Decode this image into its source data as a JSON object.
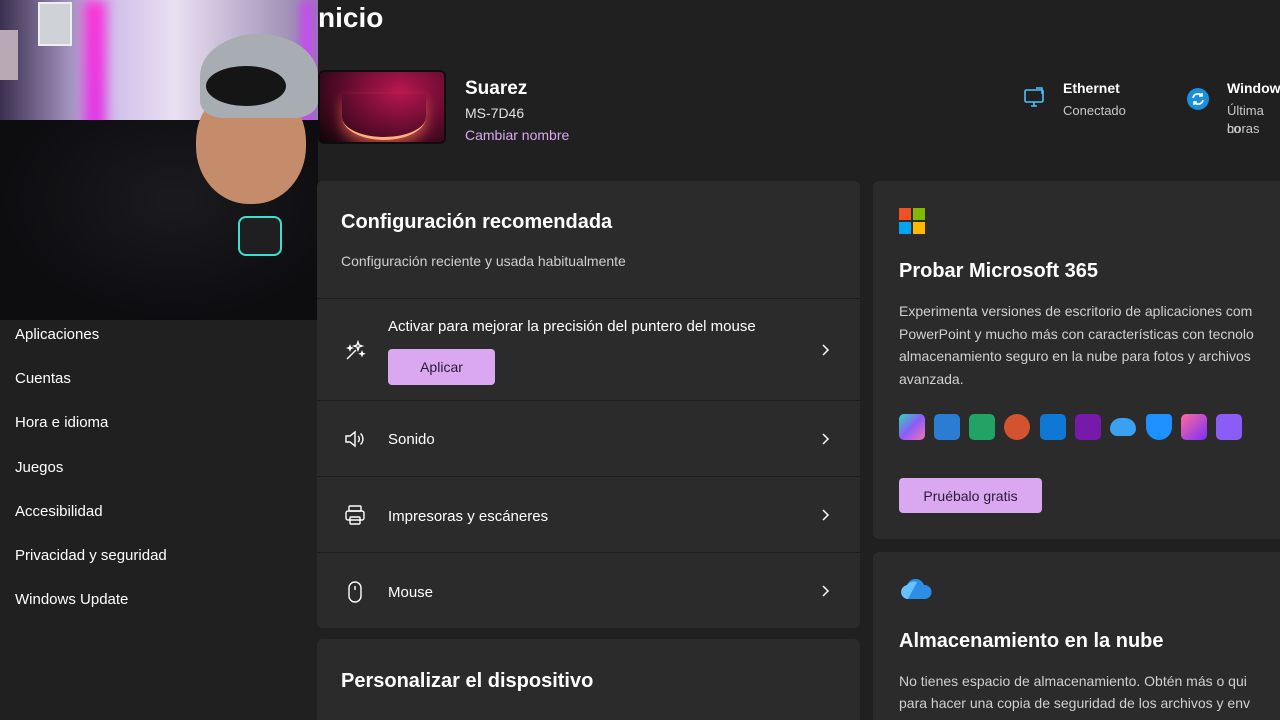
{
  "header": {
    "title": "nicio",
    "pc_name": "Suarez",
    "pc_model": "MS-7D46",
    "rename_link": "Cambiar nombre"
  },
  "status": {
    "ethernet": {
      "title": "Ethernet",
      "sub": "Conectado",
      "icon": "monitor-network-icon"
    },
    "update": {
      "title": "Window",
      "sub_line1": "Última co",
      "sub_line2": "horas",
      "icon": "sync-icon"
    }
  },
  "sidebar": {
    "items": [
      {
        "label": "Aplicaciones"
      },
      {
        "label": "Cuentas"
      },
      {
        "label": "Hora e idioma"
      },
      {
        "label": "Juegos"
      },
      {
        "label": "Accesibilidad"
      },
      {
        "label": "Privacidad y seguridad"
      },
      {
        "label": "Windows Update"
      }
    ]
  },
  "recommended": {
    "title": "Configuración recomendada",
    "subtitle": "Configuración reciente y usada habitualmente",
    "mouse_precision": {
      "label": "Activar para mejorar la precisión del puntero del mouse",
      "button": "Aplicar",
      "icon": "sparkle-pointer-icon"
    },
    "rows": [
      {
        "label": "Sonido",
        "icon": "speaker-icon"
      },
      {
        "label": "Impresoras y escáneres",
        "icon": "printer-icon"
      },
      {
        "label": "Mouse",
        "icon": "mouse-icon"
      }
    ]
  },
  "personalize": {
    "title": "Personalizar el dispositivo"
  },
  "m365": {
    "title": "Probar Microsoft 365",
    "lines": [
      "Experimenta versiones de escritorio de aplicaciones com",
      "PowerPoint y mucho más con características con tecnolo",
      "almacenamiento seguro en la nube para fotos y archivos",
      "avanzada."
    ],
    "button": "Pruébalo gratis",
    "apps": [
      "copilot-icon",
      "word-icon",
      "excel-icon",
      "powerpoint-icon",
      "outlook-icon",
      "onenote-icon",
      "onedrive-icon",
      "defender-icon",
      "clipchamp-icon",
      "designer-icon"
    ]
  },
  "cloud": {
    "title": "Almacenamiento en la nube",
    "lines": [
      "No tienes espacio de almacenamiento. Obtén más o qui",
      "para hacer una copia de seguridad de los archivos y env"
    ]
  },
  "colors": {
    "accent": "#d9a8f0",
    "card": "#2b2b2b",
    "background": "#202020"
  }
}
